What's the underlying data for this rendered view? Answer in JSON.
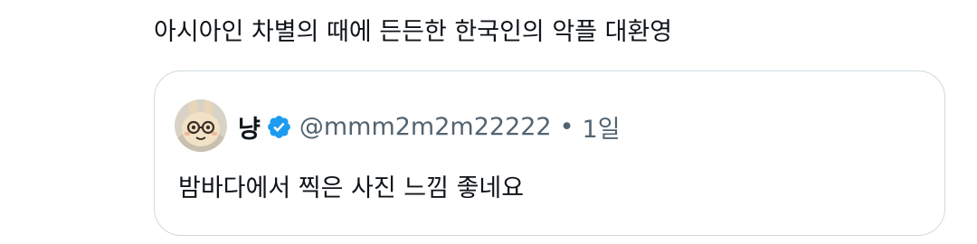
{
  "post": {
    "text": "아시아인 차별의 때에 든든한 한국인의 악플 대환영"
  },
  "quoted_post": {
    "display_name": "냥",
    "handle": "@mmm2m2m22222",
    "separator": "•",
    "timestamp": "1일",
    "text": "밤바다에서 찍은 사진 느낌 좋네요",
    "verified": true,
    "avatar_icon": "cartoon-face-with-glasses-avatar"
  },
  "colors": {
    "text_primary": "#0f1419",
    "text_secondary": "#536471",
    "card_border": "#cfd9de",
    "verified_badge": "#1d9bf0"
  }
}
